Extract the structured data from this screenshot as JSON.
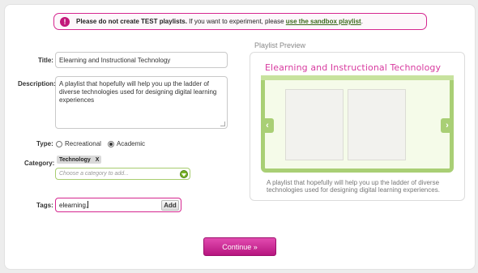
{
  "notice": {
    "bold_text": "Please do not create TEST playlists.",
    "text": " If you want to experiment, please ",
    "link": "use the sandbox playlist",
    "end": ".",
    "icon": "exclamation-icon"
  },
  "form": {
    "title_label": "Title:",
    "title_value": "Elearning and Instructional Technology",
    "description_label": "Description:",
    "description_value": "A playlist that hopefully will help you up the ladder of diverse technologies used for designing digital learning experiences",
    "type_label": "Type:",
    "type_options": [
      {
        "label": "Recreational",
        "checked": false
      },
      {
        "label": "Academic",
        "checked": true
      }
    ],
    "category_label": "Category:",
    "category_tag": "Technology",
    "category_tag_remove": "X",
    "category_placeholder": "Choose a category to add...",
    "tags_label": "Tags:",
    "tags_value": "elearning,",
    "tags_add_button": "Add"
  },
  "preview": {
    "heading": "Playlist Preview",
    "title": "Elearning and Instructional Technology",
    "description": "A playlist that hopefully will help you up the ladder of diverse technologies used for designing digital learning experiences.",
    "prev_arrow": "‹",
    "next_arrow": "›"
  },
  "actions": {
    "continue_label": "Continue »"
  },
  "colors": {
    "accent_pink": "#d5268f",
    "accent_green": "#a9cf75",
    "link_green": "#3a6b1b"
  }
}
